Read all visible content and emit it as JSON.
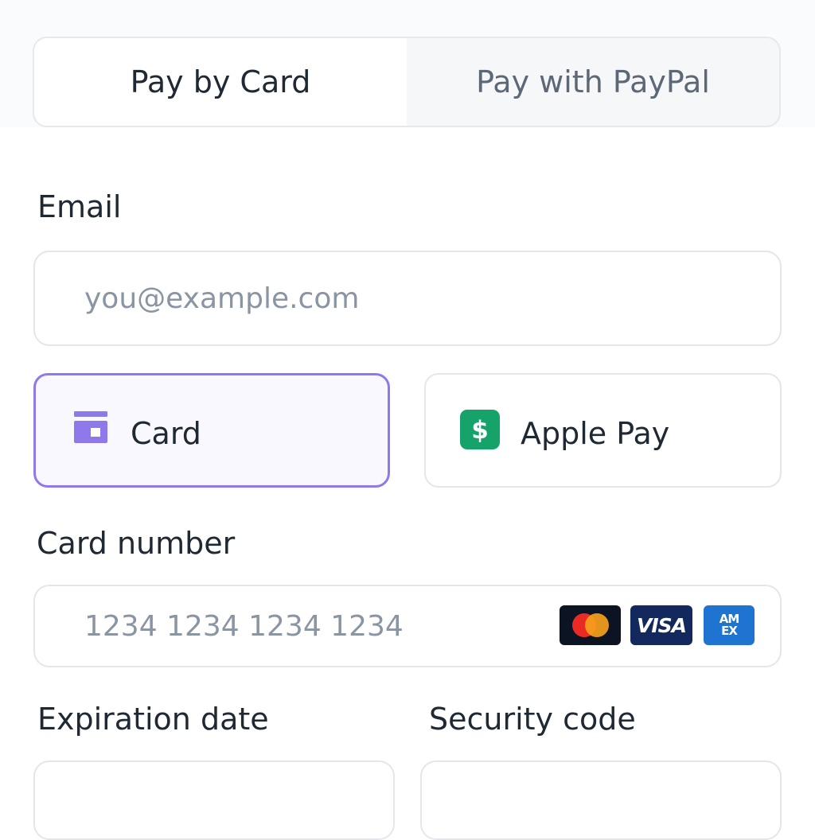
{
  "tabs": [
    {
      "label": "Pay by Card",
      "active": true
    },
    {
      "label": "Pay with PayPal",
      "active": false
    }
  ],
  "email": {
    "label": "Email",
    "placeholder": "you@example.com",
    "value": ""
  },
  "payment_methods": [
    {
      "label": "Card",
      "icon": "card-icon",
      "selected": true
    },
    {
      "label": "Apple Pay",
      "icon": "dollar-icon",
      "selected": false
    }
  ],
  "card_number": {
    "label": "Card number",
    "placeholder": "1234 1234 1234 1234",
    "value": "",
    "brands": [
      {
        "name": "mastercard-logo",
        "text": ""
      },
      {
        "name": "visa-logo",
        "text": "VISA"
      },
      {
        "name": "amex-logo",
        "text": "AM EX"
      }
    ]
  },
  "expiration": {
    "label": "Expiration date",
    "value": ""
  },
  "security_code": {
    "label": "Security code",
    "value": ""
  },
  "colors": {
    "accent": "#8f79ea",
    "accent_bg": "#faf8ff",
    "apple_pay_icon": "#16a36a",
    "visa_bg": "#13285c",
    "amex_bg": "#1f73d1",
    "mastercard_bg": "#0c1424"
  }
}
